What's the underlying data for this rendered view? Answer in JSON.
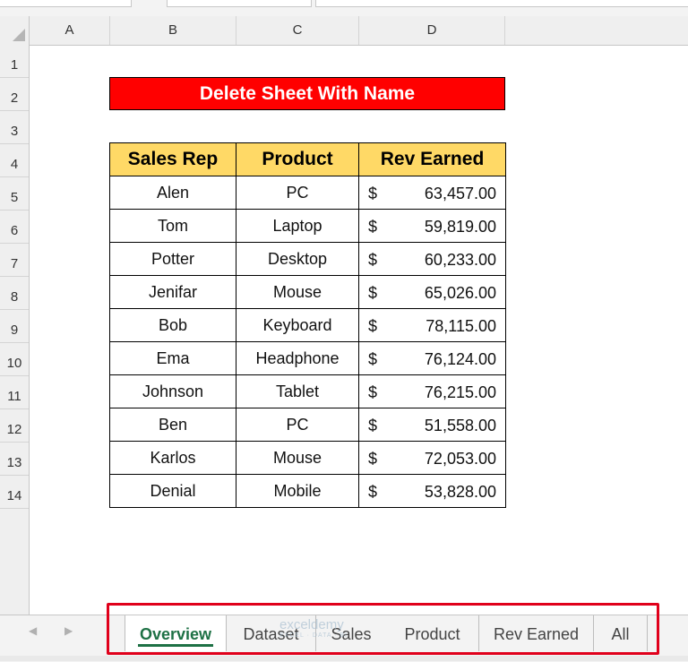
{
  "columns": [
    "A",
    "B",
    "C",
    "D"
  ],
  "rows": [
    "1",
    "2",
    "3",
    "4",
    "5",
    "6",
    "7",
    "8",
    "9",
    "10",
    "11",
    "12",
    "13",
    "14"
  ],
  "sheet": {
    "title": "Delete Sheet With Name",
    "headers": [
      "Sales Rep",
      "Product",
      "Rev Earned"
    ],
    "currency_symbol": "$",
    "records": [
      {
        "rep": "Alen",
        "product": "PC",
        "rev": "63,457.00"
      },
      {
        "rep": "Tom",
        "product": "Laptop",
        "rev": "59,819.00"
      },
      {
        "rep": "Potter",
        "product": "Desktop",
        "rev": "60,233.00"
      },
      {
        "rep": "Jenifar",
        "product": "Mouse",
        "rev": "65,026.00"
      },
      {
        "rep": "Bob",
        "product": "Keyboard",
        "rev": "78,115.00"
      },
      {
        "rep": "Ema",
        "product": "Headphone",
        "rev": "76,124.00"
      },
      {
        "rep": "Johnson",
        "product": "Tablet",
        "rev": "76,215.00"
      },
      {
        "rep": "Ben",
        "product": "PC",
        "rev": "51,558.00"
      },
      {
        "rep": "Karlos",
        "product": "Mouse",
        "rev": "72,053.00"
      },
      {
        "rep": "Denial",
        "product": "Mobile",
        "rev": "53,828.00"
      }
    ]
  },
  "tabs": [
    {
      "label": "Overview",
      "active": true
    },
    {
      "label": "Dataset",
      "active": false
    },
    {
      "label": "Sales",
      "active": false
    },
    {
      "label": "Product",
      "active": false
    },
    {
      "label": "Rev Earned",
      "active": false
    },
    {
      "label": "All",
      "active": false
    }
  ],
  "watermark": {
    "brand": "exceldemy",
    "tagline": "EXCEL · DATA · BI"
  },
  "colors": {
    "title_bg": "#ff0000",
    "header_bg": "#ffd966",
    "active_tab": "#1e7145",
    "highlight_box": "#e0001b"
  },
  "icons": {
    "prev_sheet": "triangle-left-icon",
    "next_sheet": "triangle-right-icon",
    "select_all": "select-all-triangle-icon"
  }
}
